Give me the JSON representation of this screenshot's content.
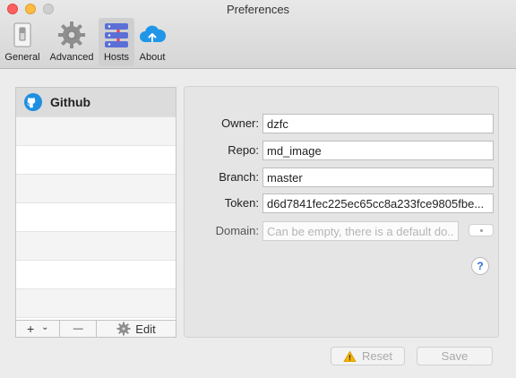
{
  "window": {
    "title": "Preferences"
  },
  "toolbar": {
    "items": [
      {
        "label": "General",
        "icon": "switch-icon"
      },
      {
        "label": "Advanced",
        "icon": "gear-icon"
      },
      {
        "label": "Hosts",
        "icon": "hosts-icon",
        "selected": true
      },
      {
        "label": "About",
        "icon": "cloud-upload-icon"
      }
    ]
  },
  "sidebar": {
    "hosts": [
      {
        "label": "Github",
        "icon": "github-icon",
        "selected": true
      }
    ],
    "add_label": "+",
    "add_menu_label": "⌄",
    "remove_label": "—",
    "edit_label": "Edit"
  },
  "form": {
    "owner": {
      "label": "Owner:",
      "value": "dzfc"
    },
    "repo": {
      "label": "Repo:",
      "value": "md_image"
    },
    "branch": {
      "label": "Branch:",
      "value": "master"
    },
    "token": {
      "label": "Token:",
      "value": "d6d7841fec225ec65cc8a233fce9805fbe..."
    },
    "domain": {
      "label": "Domain:",
      "value": "",
      "placeholder": "Can be empty, there is a default do..."
    },
    "help_label": "?"
  },
  "buttons": {
    "reset_label": "Reset",
    "save_label": "Save"
  },
  "colors": {
    "accent": "#2f6dd4",
    "github_blue": "#1f8fe0",
    "warning": "#f5b400"
  }
}
